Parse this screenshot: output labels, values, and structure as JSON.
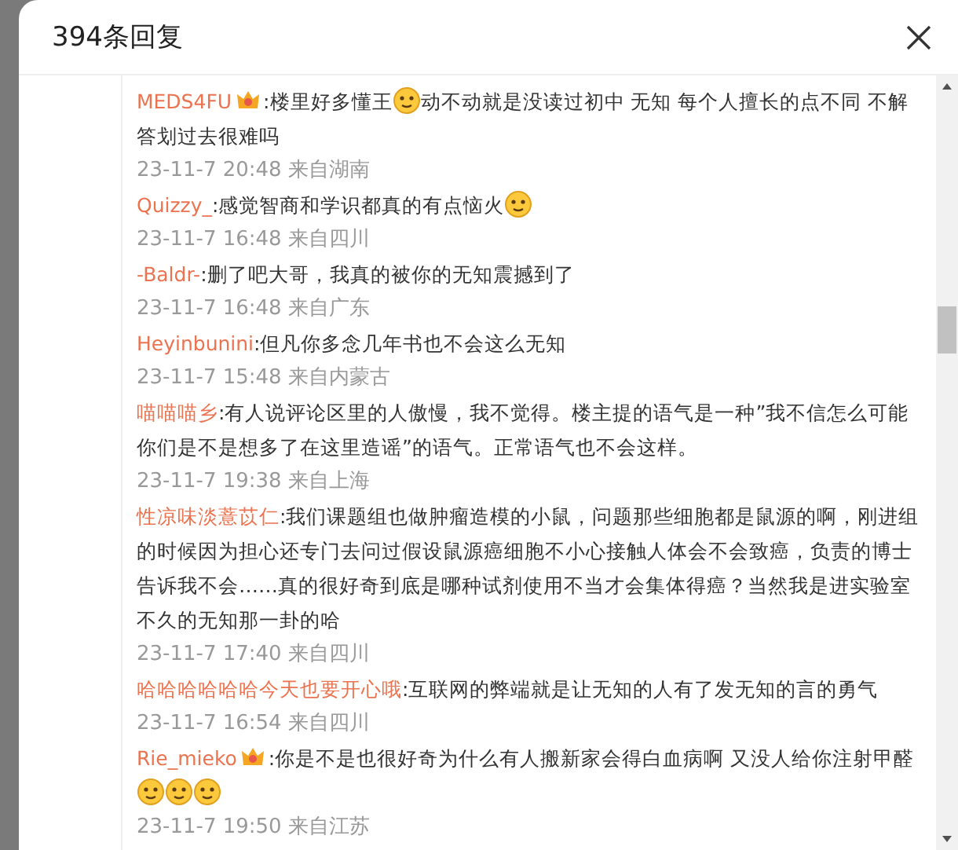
{
  "dialog": {
    "title": "394条回复"
  },
  "replies": [
    {
      "user": "MEDS4FU",
      "badge": true,
      "body": [
        {
          "kind": "text",
          "text": ":楼里好多懂王"
        },
        {
          "kind": "emoji"
        },
        {
          "kind": "text",
          "text": "动不动就是没读过初中 无知 每个人擅长的点不同 不解答划过去很难吗"
        }
      ],
      "meta": "23-11-7 20:48 来自湖南"
    },
    {
      "user": "Quizzy_",
      "badge": false,
      "body": [
        {
          "kind": "text",
          "text": ":感觉智商和学识都真的有点恼火"
        },
        {
          "kind": "emoji"
        }
      ],
      "meta": "23-11-7 16:48 来自四川"
    },
    {
      "user": "-Baldr-",
      "badge": false,
      "body": [
        {
          "kind": "text",
          "text": ":删了吧大哥，我真的被你的无知震撼到了"
        }
      ],
      "meta": "23-11-7 16:48 来自广东"
    },
    {
      "user": "Heyinbunini",
      "badge": false,
      "body": [
        {
          "kind": "text",
          "text": ":但凡你多念几年书也不会这么无知"
        }
      ],
      "meta": "23-11-7 15:48 来自内蒙古"
    },
    {
      "user": "喵喵喵乡",
      "badge": false,
      "body": [
        {
          "kind": "text",
          "text": ":有人说评论区里的人傲慢，我不觉得。楼主提的语气是一种”我不信怎么可能你们是不是想多了在这里造谣”的语气。正常语气也不会这样。"
        }
      ],
      "meta": "23-11-7 19:38 来自上海"
    },
    {
      "user": "性凉味淡薏苡仁",
      "badge": false,
      "body": [
        {
          "kind": "text",
          "text": ":我们课题组也做肿瘤造模的小鼠，问题那些细胞都是鼠源的啊，刚进组的时候因为担心还专门去问过假设鼠源癌细胞不小心接触人体会不会致癌，负责的博士告诉我不会……真的很好奇到底是哪种试剂使用不当才会集体得癌？当然我是进实验室不久的无知那一卦的哈"
        }
      ],
      "meta": "23-11-7 17:40 来自四川"
    },
    {
      "user": "哈哈哈哈哈哈今天也要开心哦",
      "badge": false,
      "body": [
        {
          "kind": "text",
          "text": ":互联网的弊端就是让无知的人有了发无知的言的勇气"
        }
      ],
      "meta": "23-11-7 16:54 来自四川"
    },
    {
      "user": "Rie_mieko",
      "badge": true,
      "body": [
        {
          "kind": "text",
          "text": ":你是不是也很好奇为什么有人搬新家会得白血病啊  又没人给你注射甲醛"
        },
        {
          "kind": "emoji"
        },
        {
          "kind": "emoji"
        },
        {
          "kind": "emoji"
        }
      ],
      "meta": "23-11-7 19:50 来自江苏"
    }
  ]
}
